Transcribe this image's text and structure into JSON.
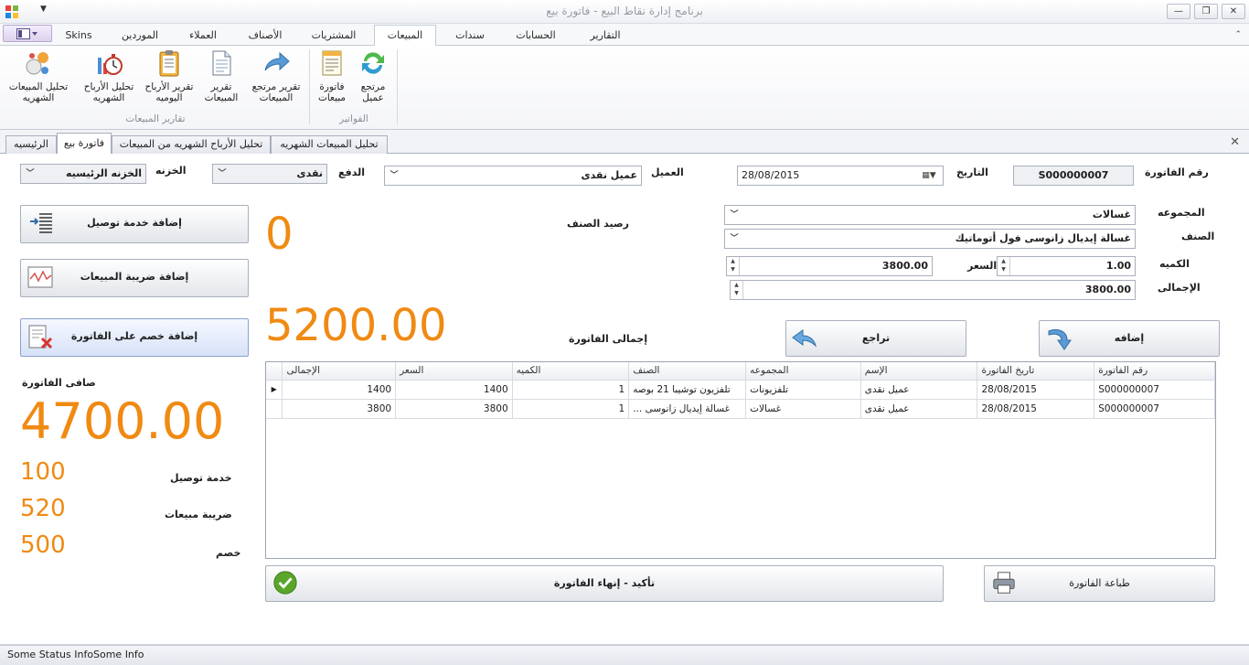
{
  "window": {
    "title": "برنامج إدارة نقاط البيع - فاتورة بيع",
    "minimize": "—",
    "restore": "❐",
    "close": "✕"
  },
  "ribbon_tabs": [
    {
      "label": "Skins"
    },
    {
      "label": "الموردين"
    },
    {
      "label": "العملاء"
    },
    {
      "label": "الأصناف"
    },
    {
      "label": "المشتريات"
    },
    {
      "label": "المبيعات",
      "active": true
    },
    {
      "label": "سندات"
    },
    {
      "label": "الحسابات"
    },
    {
      "label": "التقارير"
    }
  ],
  "ribbon": {
    "group_reports": "تقارير المبيعات",
    "group_invoices": "الفواتير",
    "buttons": {
      "monthly_sales_analysis": [
        "تحليل المبيعات",
        "الشهريه"
      ],
      "monthly_profit_analysis": [
        "تحليل الأرباح",
        "الشهريه"
      ],
      "daily_profit_report": [
        "تقرير الأرباح",
        "اليوميه"
      ],
      "sales_report": [
        "تقرير",
        "المبيعات"
      ],
      "sales_return_report": [
        "تقرير مرتجع",
        "المبيعات"
      ],
      "sales_invoice": [
        "فاتورة",
        "مبيعات"
      ],
      "customer_return": [
        "مرتجع",
        "عميل"
      ]
    }
  },
  "doc_tabs": [
    {
      "label": "الرئيسيه"
    },
    {
      "label": "فاتورة بيع",
      "active": true
    },
    {
      "label": "تحليل الأرباح الشهريه من المبيعات"
    },
    {
      "label": "تحليل المبيعات الشهريه"
    }
  ],
  "header": {
    "invoice_no_label": "رقم الفاتورة",
    "invoice_no": "S000000007",
    "date_label": "التاريخ",
    "date": "28/08/2015",
    "customer_label": "العميل",
    "customer": "عميل نقدى",
    "payment_label": "الدفع",
    "payment": "نقدى",
    "store_label": "الخزنه",
    "store": "الخزنه الرئيسيه"
  },
  "item": {
    "group_label": "المجموعه",
    "group": "غسالات",
    "product_label": "الصنف",
    "product": "غسالة إيديال زانوسى فول أتوماتيك",
    "qty_label": "الكميه",
    "qty": "1.00",
    "price_label": "السعر",
    "price": "3800.00",
    "total_label": "الإجمالى",
    "total": "3800.00",
    "stock_label": "رصيد الصنف",
    "stock_value": "0",
    "invoice_total_label": "إجمالى الفاتورة",
    "invoice_total": "5200.00",
    "add_button": "إضافه",
    "undo_button": "تراجع"
  },
  "side": {
    "delivery_button": "إضافة خدمة توصيل",
    "tax_button": "إضافة ضريبة المبيعات",
    "discount_button": "إضافة خصم على الفاتورة",
    "net_label": "صافى الفاتورة",
    "net_value": "4700.00",
    "delivery_label": "خدمة توصيل",
    "delivery_value": "100",
    "tax_label": "ضريبة مبيعات",
    "tax_value": "520",
    "discount_label": "خصم",
    "discount_value": "500"
  },
  "grid": {
    "columns": [
      "رقم الفاتورة",
      "تاريخ الفاتورة",
      "الإسم",
      "المجموعه",
      "الصنف",
      "الكميه",
      "السعر",
      "الإجمالى"
    ],
    "rows": [
      [
        "S000000007",
        "28/08/2015",
        "عميل نقدى",
        "تلفزيونات",
        "تلفزيون توشيبا 21 بوصه",
        "1",
        "1400",
        "1400"
      ],
      [
        "S000000007",
        "28/08/2015",
        "عميل نقدى",
        "غسالات",
        "... غسالة إيديال زانوسى",
        "1",
        "3800",
        "3800"
      ]
    ]
  },
  "footer": {
    "print_button": "طباعة الفاتورة",
    "confirm_button": "تأكيد - إنهاء الفاتورة"
  },
  "status": {
    "left": "Some Status Info",
    "right": "Some Info"
  },
  "colors": {
    "accent": "#f08a12",
    "ribbon_bg": "#ffffff",
    "confirm": "#5aa52a"
  }
}
